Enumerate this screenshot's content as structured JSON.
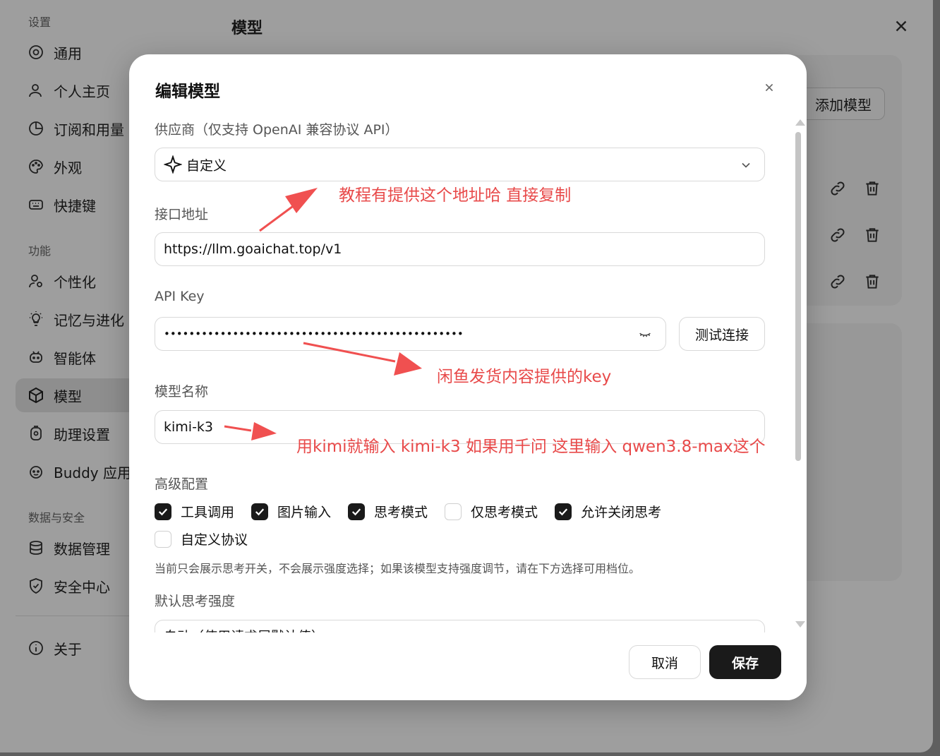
{
  "sidebar": {
    "sections": [
      {
        "title": "设置"
      },
      {
        "title": "功能"
      },
      {
        "title": "数据与安全"
      }
    ],
    "items": [
      {
        "label": "通用",
        "icon": "gear-icon"
      },
      {
        "label": "个人主页",
        "icon": "user-icon"
      },
      {
        "label": "订阅和用量",
        "icon": "pie-icon"
      },
      {
        "label": "外观",
        "icon": "palette-icon"
      },
      {
        "label": "快捷键",
        "icon": "keyboard-icon"
      },
      {
        "label": "个性化",
        "icon": "user-gear-icon"
      },
      {
        "label": "记忆与进化",
        "icon": "bulb-icon"
      },
      {
        "label": "智能体",
        "icon": "robot-icon"
      },
      {
        "label": "模型",
        "icon": "cube-icon"
      },
      {
        "label": "助理设置",
        "icon": "assistant-icon"
      },
      {
        "label": "Buddy 应用",
        "icon": "buddy-icon"
      },
      {
        "label": "数据管理",
        "icon": "database-icon"
      },
      {
        "label": "安全中心",
        "icon": "shield-icon"
      },
      {
        "label": "关于",
        "icon": "info-icon"
      }
    ],
    "active_item": "模型"
  },
  "main": {
    "title": "模型",
    "add_model_label": "添加模型"
  },
  "modal": {
    "title": "编辑模型",
    "provider_label": "供应商（仅支持 OpenAI 兼容协议 API）",
    "provider_value": "自定义",
    "endpoint_label": "接口地址",
    "endpoint_value": "https://llm.goaichat.top/v1",
    "apikey_label": "API Key",
    "apikey_value": "••••••••••••••••••••••••••••••••••••••••••••••••",
    "test_button": "测试连接",
    "model_name_label": "模型名称",
    "model_name_value": "kimi-k3",
    "advanced_label": "高级配置",
    "checkboxes": [
      {
        "label": "工具调用",
        "checked": true
      },
      {
        "label": "图片输入",
        "checked": true
      },
      {
        "label": "思考模式",
        "checked": true
      },
      {
        "label": "仅思考模式",
        "checked": false
      },
      {
        "label": "允许关闭思考",
        "checked": true
      },
      {
        "label": "自定义协议",
        "checked": false
      }
    ],
    "hint": "当前只会展示思考开关，不会展示强度选择；如果该模型支持强度调节，请在下方选择可用档位。",
    "default_strength_label": "默认思考强度",
    "default_strength_value": "自动（使用请求层默认值）",
    "cancel_button": "取消",
    "save_button": "保存"
  },
  "annotations": [
    {
      "text": "教程有提供这个地址哈 直接复制"
    },
    {
      "text": "闲鱼发货内容提供的key"
    },
    {
      "text": "用kimi就输入 kimi-k3  如果用千问 这里输入 qwen3.8-max这个"
    }
  ],
  "colors": {
    "annotation": "#e84a4a",
    "primary_button": "#1a1a1a",
    "overlay": "rgba(0,0,0,0.38)"
  }
}
